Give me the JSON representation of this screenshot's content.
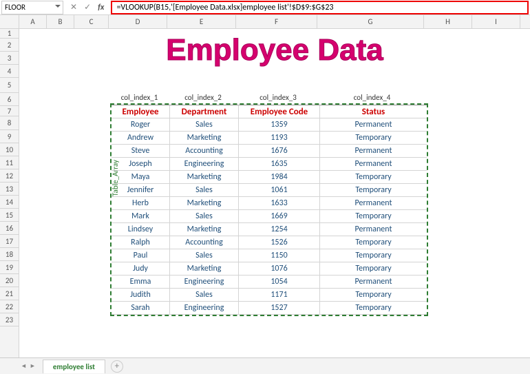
{
  "formula_bar": {
    "namebox": "FLOOR",
    "formula": "=VLOOKUP(B15,'[Employee Data.xlsx]employee list'!$D$9:$G$23"
  },
  "columns": [
    "A",
    "B",
    "C",
    "D",
    "E",
    "F",
    "G",
    "H",
    "I"
  ],
  "rows": [
    "1",
    "2",
    "3",
    "4",
    "5",
    "6",
    "7",
    "8",
    "9",
    "10",
    "11",
    "12",
    "13",
    "14",
    "15",
    "16",
    "17",
    "18",
    "19",
    "20",
    "21",
    "22",
    "23"
  ],
  "title": "Employee Data",
  "col_labels": [
    "col_index_1",
    "col_index_2",
    "col_index_3",
    "col_index_4"
  ],
  "table_array_label": "Table_Array",
  "headers": [
    "Employee",
    "Department",
    "Employee Code",
    "Status"
  ],
  "data_rows": [
    [
      "Roger",
      "Sales",
      "1359",
      "Permanent"
    ],
    [
      "Andrew",
      "Marketing",
      "1193",
      "Temporary"
    ],
    [
      "Steve",
      "Accounting",
      "1676",
      "Permanent"
    ],
    [
      "Joseph",
      "Engineering",
      "1635",
      "Permanent"
    ],
    [
      "Maya",
      "Marketing",
      "1984",
      "Temporary"
    ],
    [
      "Jennifer",
      "Sales",
      "1061",
      "Temporary"
    ],
    [
      "Herb",
      "Marketing",
      "1633",
      "Permanent"
    ],
    [
      "Mark",
      "Sales",
      "1669",
      "Temporary"
    ],
    [
      "Lindsey",
      "Marketing",
      "1254",
      "Permanent"
    ],
    [
      "Ralph",
      "Accounting",
      "1526",
      "Temporary"
    ],
    [
      "Paul",
      "Sales",
      "1150",
      "Temporary"
    ],
    [
      "Judy",
      "Marketing",
      "1076",
      "Temporary"
    ],
    [
      "Emma",
      "Engineering",
      "1054",
      "Permanent"
    ],
    [
      "Judith",
      "Sales",
      "1171",
      "Temporary"
    ],
    [
      "Sarah",
      "Engineering",
      "1527",
      "Temporary"
    ]
  ],
  "tabs": {
    "active": "employee list"
  },
  "chart_data": {
    "type": "table",
    "title": "Employee Data",
    "columns": [
      "Employee",
      "Department",
      "Employee Code",
      "Status"
    ],
    "rows": [
      [
        "Roger",
        "Sales",
        1359,
        "Permanent"
      ],
      [
        "Andrew",
        "Marketing",
        1193,
        "Temporary"
      ],
      [
        "Steve",
        "Accounting",
        1676,
        "Permanent"
      ],
      [
        "Joseph",
        "Engineering",
        1635,
        "Permanent"
      ],
      [
        "Maya",
        "Marketing",
        1984,
        "Temporary"
      ],
      [
        "Jennifer",
        "Sales",
        1061,
        "Temporary"
      ],
      [
        "Herb",
        "Marketing",
        1633,
        "Permanent"
      ],
      [
        "Mark",
        "Sales",
        1669,
        "Temporary"
      ],
      [
        "Lindsey",
        "Marketing",
        1254,
        "Permanent"
      ],
      [
        "Ralph",
        "Accounting",
        1526,
        "Temporary"
      ],
      [
        "Paul",
        "Sales",
        1150,
        "Temporary"
      ],
      [
        "Judy",
        "Marketing",
        1076,
        "Temporary"
      ],
      [
        "Emma",
        "Engineering",
        1054,
        "Permanent"
      ],
      [
        "Judith",
        "Sales",
        1171,
        "Temporary"
      ],
      [
        "Sarah",
        "Engineering",
        1527,
        "Temporary"
      ]
    ]
  }
}
